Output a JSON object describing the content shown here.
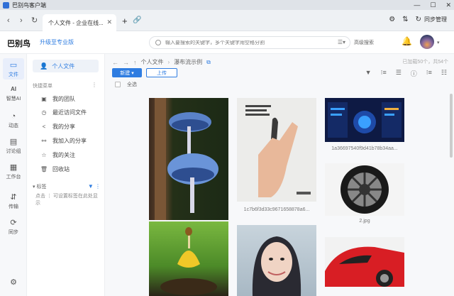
{
  "titlebar": {
    "title": "巴别鸟客户端",
    "minimize": "—",
    "maximize": "☐",
    "close": "✕"
  },
  "tabbar": {
    "back": "‹",
    "forward": "›",
    "reload": "↻",
    "tab_title": "个人文件 - 企业在线...",
    "tab_close": "✕",
    "add": "+",
    "link": "🔗",
    "gear": "⚙",
    "sync_arrows": "⇅",
    "sync_icon": "↻",
    "sync_label": "同步管理"
  },
  "header": {
    "brand": "巴别鸟",
    "upgrade": "升级至专业版",
    "search_placeholder": "输入要搜索的关键字，多个关键字用空格分割",
    "filter": "☰▾",
    "advanced": "高级搜索",
    "bell": "🔔",
    "avatar_caret": "▾"
  },
  "rail": [
    {
      "icon": "▭",
      "label": "文件"
    },
    {
      "icon": "AI",
      "label": "智慧AI"
    },
    {
      "icon": "◔",
      "label": "动态"
    },
    {
      "icon": "▤",
      "label": "讨论组"
    },
    {
      "icon": "▦",
      "label": "工作台"
    },
    {
      "icon": "⇵",
      "label": "传输"
    },
    {
      "icon": "⟳",
      "label": "同步"
    }
  ],
  "rail_settings": "⚙",
  "side": {
    "personal_icon": "👤",
    "personal": "个人文件",
    "quick_menu": "快捷菜单",
    "more": "⋮",
    "menu": [
      {
        "icon": "▣",
        "label": "我的团队"
      },
      {
        "icon": "◷",
        "label": "最近访问文件"
      },
      {
        "icon": "<",
        "label": "我的分享"
      },
      {
        "icon": "⚯",
        "label": "我加入的分享"
      },
      {
        "icon": "☆",
        "label": "我的关注"
      },
      {
        "icon": "🗑",
        "label": "回收站"
      }
    ],
    "tags_label": "▾ 标签",
    "tags_tools": "▼ ⋮",
    "tags_hint": "点击 ⋮ 可设置标签在此处显示"
  },
  "content": {
    "back": "←",
    "forward": "→",
    "up": "↑",
    "crumb_root": "个人文件",
    "crumb_sep": "›",
    "crumb_current": "瀑布流示例",
    "crumb_link": "⧉",
    "storage": "已加载50个，共54个",
    "new_label": "新建 ▾",
    "upload_label": "上传",
    "toolbar": [
      "▼",
      "⁝≡",
      "☰",
      "ⓘ",
      "⁝≡",
      "☷"
    ],
    "select_all": "全选",
    "files": [
      {
        "name": ""
      },
      {
        "name": "1c7b6f3d33c9671658878a6..."
      },
      {
        "name": "1a36697540f9d41b78b34aa..."
      },
      {
        "name": "2.jpg"
      },
      {
        "name": ""
      },
      {
        "name": ""
      }
    ]
  }
}
